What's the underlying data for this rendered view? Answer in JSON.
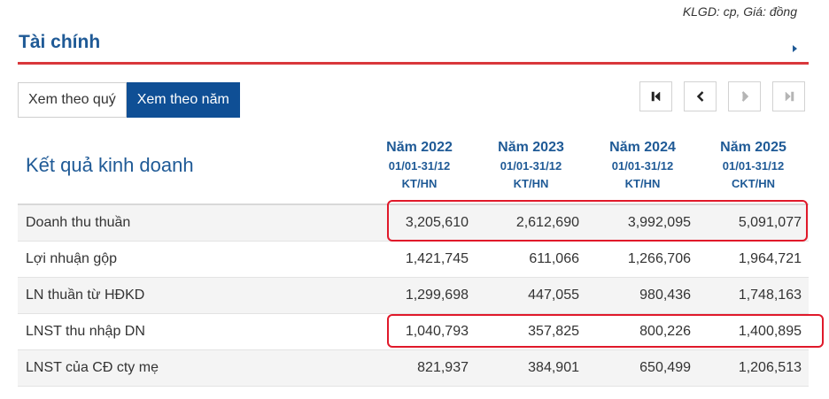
{
  "header": {
    "unit_note": "KLGD: cp, Giá: đồng",
    "section_title": "Tài chính"
  },
  "view_toggle": {
    "quarter_label": "Xem theo quý",
    "year_label": "Xem theo năm",
    "selected": "Xem theo năm"
  },
  "nav": {
    "first_icon": "skip-first-icon",
    "prev_icon": "chevron-left-icon",
    "next_icon": "chevron-right-icon",
    "last_icon": "skip-last-icon"
  },
  "table": {
    "title": "Kết quả kinh doanh",
    "columns": [
      {
        "year": "Năm 2022",
        "period": "01/01-31/12",
        "audit": "KT/HN"
      },
      {
        "year": "Năm 2023",
        "period": "01/01-31/12",
        "audit": "KT/HN"
      },
      {
        "year": "Năm 2024",
        "period": "01/01-31/12",
        "audit": "KT/HN"
      },
      {
        "year": "Năm 2025",
        "period": "01/01-31/12",
        "audit": "CKT/HN"
      }
    ],
    "rows": [
      {
        "label": "Doanh thu thuần",
        "values": [
          "3,205,610",
          "2,612,690",
          "3,992,095",
          "5,091,077"
        ],
        "highlighted": true
      },
      {
        "label": "Lợi nhuận gộp",
        "values": [
          "1,421,745",
          "611,066",
          "1,266,706",
          "1,964,721"
        ],
        "highlighted": false
      },
      {
        "label": "LN thuần từ HĐKD",
        "values": [
          "1,299,698",
          "447,055",
          "980,436",
          "1,748,163"
        ],
        "highlighted": false
      },
      {
        "label": "LNST thu nhập DN",
        "values": [
          "1,040,793",
          "357,825",
          "800,226",
          "1,400,895"
        ],
        "highlighted": true
      },
      {
        "label": "LNST của CĐ cty mẹ",
        "values": [
          "821,937",
          "384,901",
          "650,499",
          "1,206,513"
        ],
        "highlighted": false
      }
    ]
  },
  "colors": {
    "accent_blue": "#1f5a96",
    "active_button": "#0f4f95",
    "rule_red": "#d9373b",
    "highlight_red": "#e0192a"
  }
}
